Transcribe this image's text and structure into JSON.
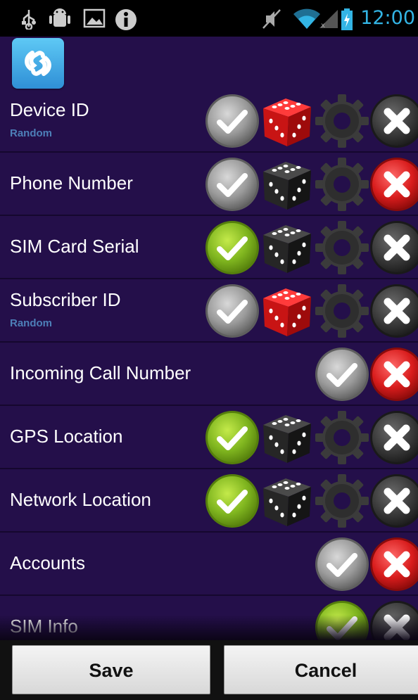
{
  "status_bar": {
    "time": "12:00",
    "icons": [
      "usb-icon",
      "android-debug-icon",
      "image-icon",
      "info-icon",
      "mute-icon",
      "wifi-icon",
      "signal-icon",
      "battery-icon"
    ]
  },
  "app": {
    "icon": "shazam-logo-icon"
  },
  "rows": [
    {
      "label": "Device ID",
      "sublabel": "Random",
      "check": "gray",
      "dice": "red",
      "has_gear": true,
      "cross": "dark"
    },
    {
      "label": "Phone Number",
      "sublabel": "",
      "check": "gray",
      "dice": "black",
      "has_gear": true,
      "cross": "red"
    },
    {
      "label": "SIM Card Serial",
      "sublabel": "",
      "check": "green",
      "dice": "black",
      "has_gear": true,
      "cross": "dark"
    },
    {
      "label": "Subscriber ID",
      "sublabel": "Random",
      "check": "gray",
      "dice": "red",
      "has_gear": true,
      "cross": "dark"
    },
    {
      "label": "Incoming Call Number",
      "sublabel": "",
      "check": "gray",
      "dice": "",
      "has_gear": false,
      "cross": "red"
    },
    {
      "label": "GPS Location",
      "sublabel": "",
      "check": "green",
      "dice": "black",
      "has_gear": true,
      "cross": "dark"
    },
    {
      "label": "Network Location",
      "sublabel": "",
      "check": "green",
      "dice": "black",
      "has_gear": true,
      "cross": "dark"
    },
    {
      "label": "Accounts",
      "sublabel": "",
      "check": "gray",
      "dice": "",
      "has_gear": false,
      "cross": "red"
    },
    {
      "label": "SIM Info",
      "sublabel": "",
      "check": "green",
      "dice": "",
      "has_gear": false,
      "cross": "dark"
    }
  ],
  "buttons": {
    "save": "Save",
    "cancel": "Cancel"
  },
  "colors": {
    "background": "#240f4a",
    "accent_clock": "#33b5e5",
    "sublabel": "#4d7fb8"
  }
}
